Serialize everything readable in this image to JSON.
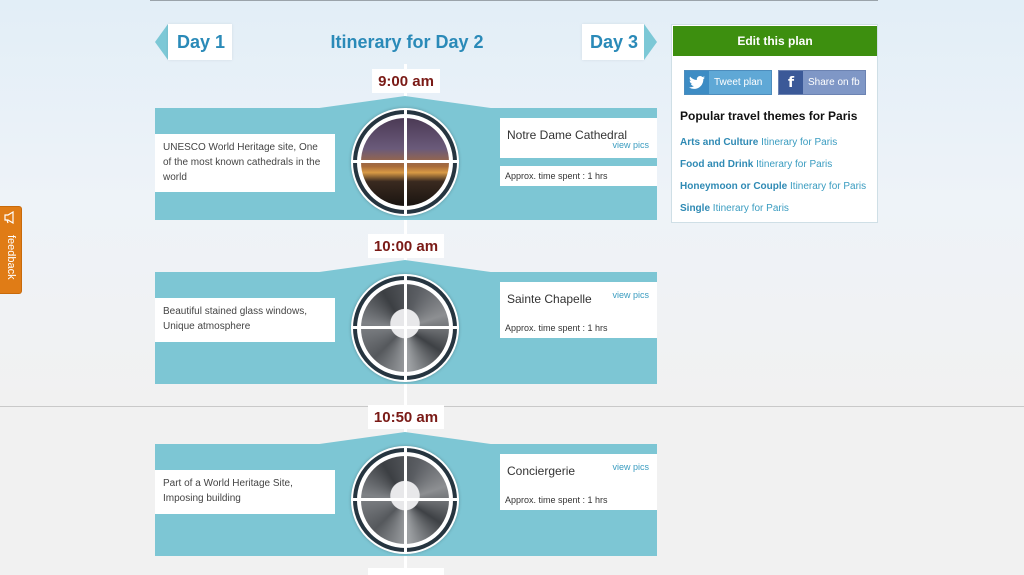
{
  "nav": {
    "prev_day": "Day 1",
    "title": "Itinerary for Day 2",
    "next_day": "Day 3"
  },
  "stops": [
    {
      "time": "9:00 am",
      "name": "Notre Dame Cathedral",
      "view_pics": "view pics",
      "time_spent": "Approx. time spent : 1 hrs",
      "description": "UNESCO World Heritage site, One of the most known cathedrals in the world"
    },
    {
      "time": "10:00 am",
      "name": "Sainte Chapelle",
      "view_pics": "view pics",
      "time_spent": "Approx. time spent : 1 hrs",
      "description": "Beautiful stained glass windows, Unique atmosphere"
    },
    {
      "time": "10:50 am",
      "name": "Conciergerie",
      "view_pics": "view pics",
      "time_spent": "Approx. time spent : 1 hrs",
      "description": "Part of a World Heritage Site, Imposing building"
    }
  ],
  "sidebar": {
    "edit_button": "Edit this plan",
    "tweet_button": "Tweet plan",
    "fb_button": "Share on fb",
    "themes_title": "Popular travel themes for Paris",
    "themes": [
      {
        "theme": "Arts and Culture",
        "suffix": "Itinerary for Paris"
      },
      {
        "theme": "Food and Drink",
        "suffix": "Itinerary for Paris"
      },
      {
        "theme": "Honeymoon or Couple",
        "suffix": "Itinerary for Paris"
      },
      {
        "theme": "Single",
        "suffix": "Itinerary for Paris"
      }
    ]
  },
  "feedback": {
    "label": "feedback"
  },
  "colors": {
    "accent": "#2a8ab8",
    "band": "#7dc6d4",
    "edit_button": "#3d8f0f",
    "time": "#7a1a16",
    "feedback": "#e07c16"
  }
}
